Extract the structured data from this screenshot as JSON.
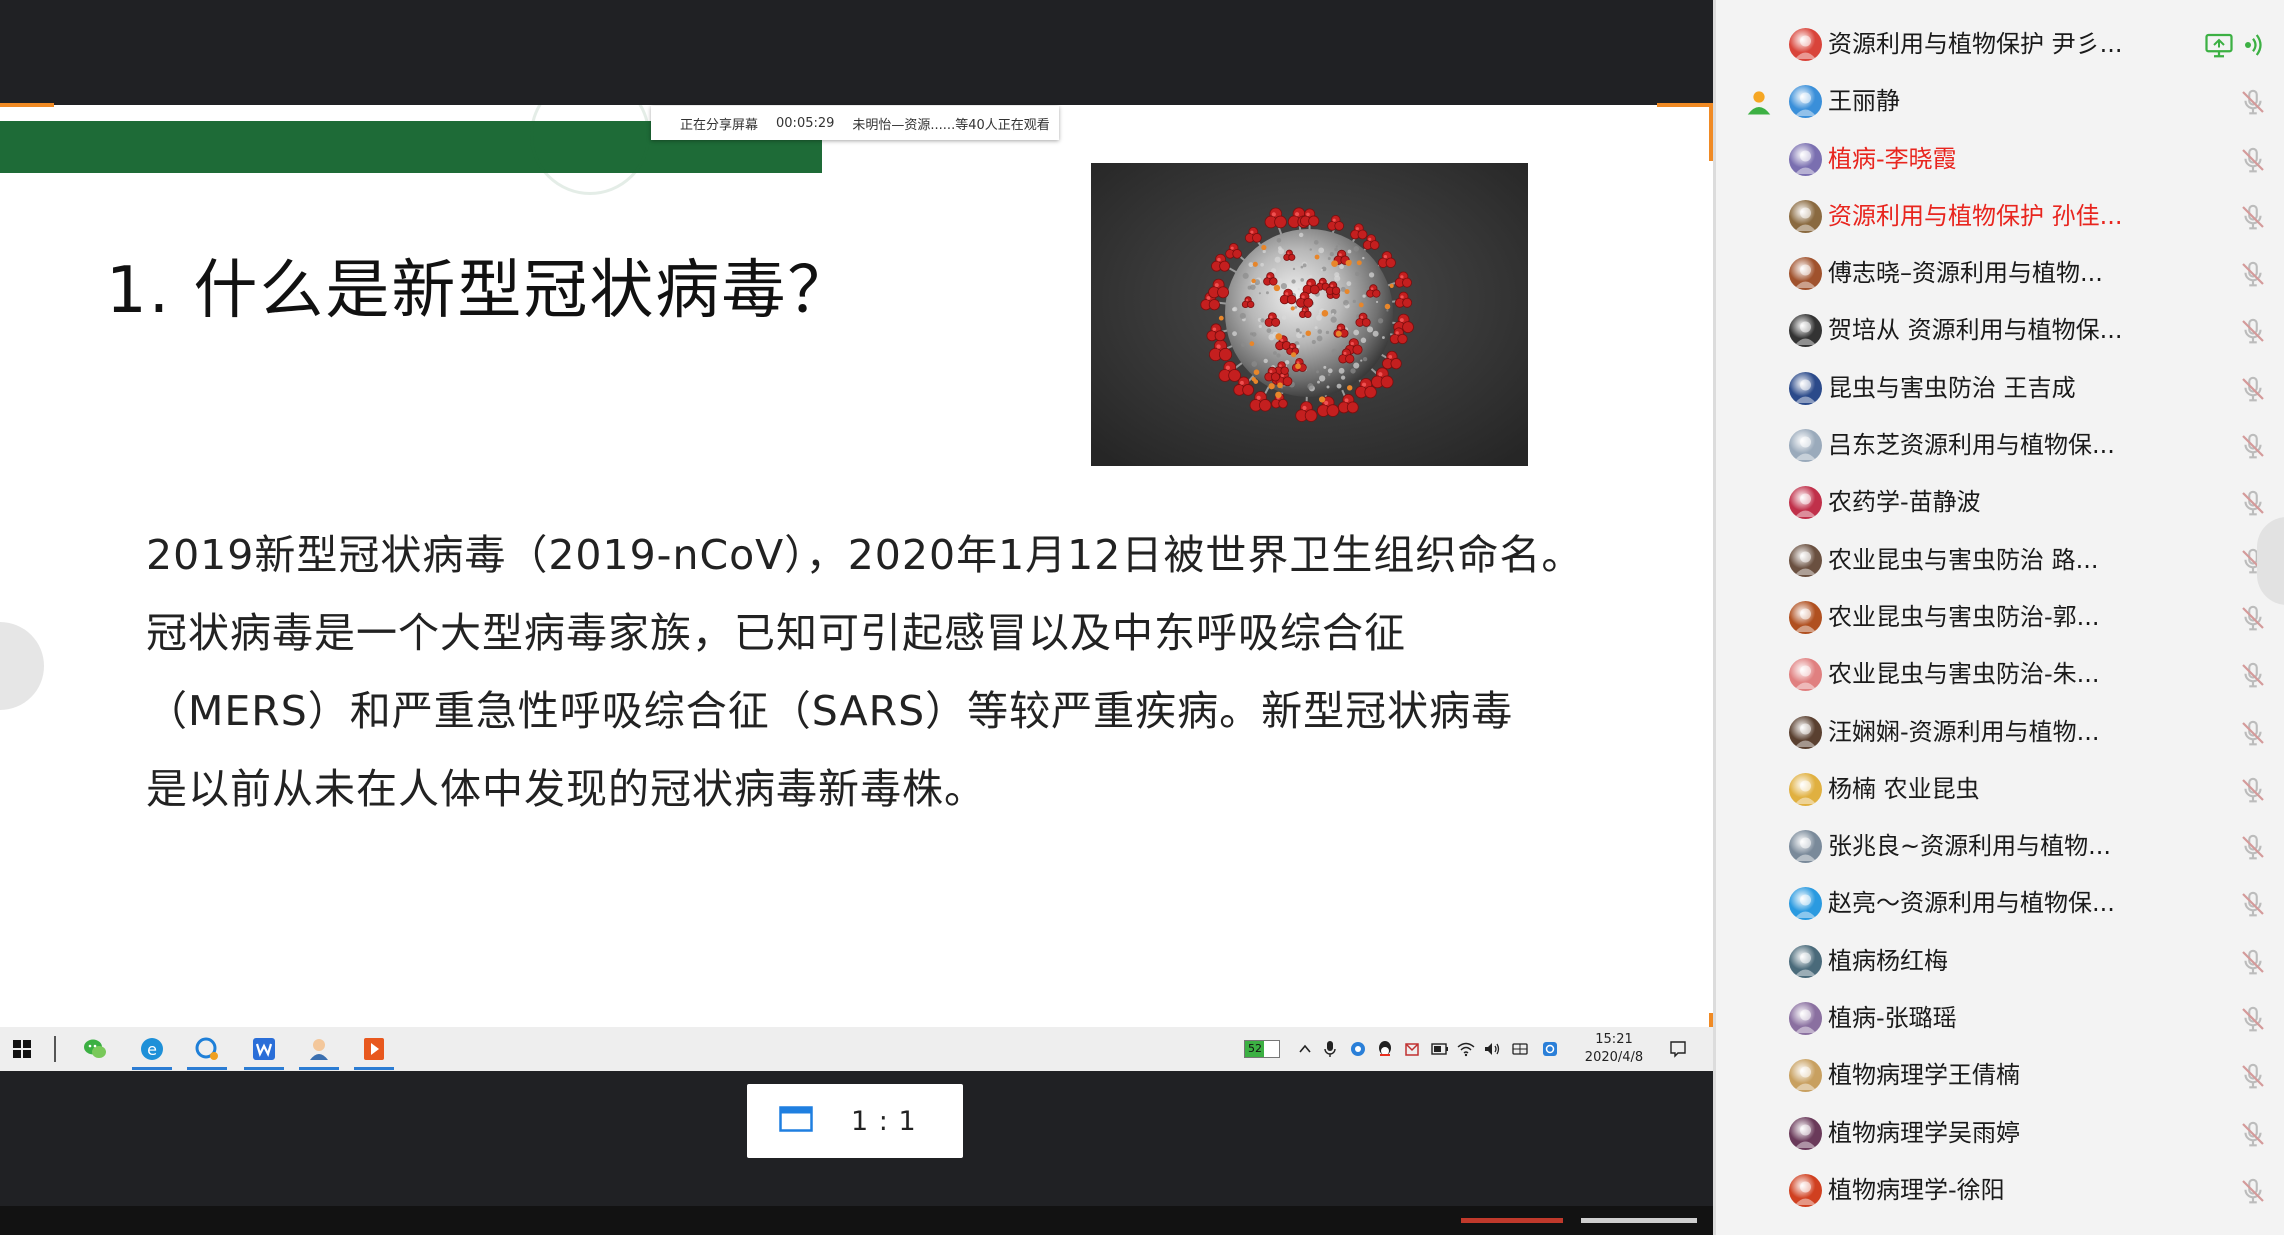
{
  "share_bar": {
    "status": "正在分享屏幕",
    "timer": "00:05:29",
    "viewers": "未明怡—资源......等40人正在观看"
  },
  "slide": {
    "title": "1. 什么是新型冠状病毒？",
    "paragraph": [
      "2019新型冠状病毒（2019-nCoV），2020年1月12日被世界卫生组织命名。",
      "冠状病毒是一个大型病毒家族，已知可引起感冒以及中东呼吸综合征",
      "（MERS）和严重急性呼吸综合征（SARS）等较严重疾病。新型冠状病毒",
      "是以前从未在人体中发现的冠状病毒新毒株。"
    ],
    "image_icon": "coronavirus-illustration"
  },
  "taskbar": {
    "battery": "52",
    "time": "15:21",
    "date": "2020/4/8"
  },
  "view": {
    "zoom_label": "1 : 1"
  },
  "colors": {
    "share_border_orange": "#f08a24",
    "slide_green": "#1e6b37",
    "name_highlight_red": "#e8251e",
    "active_green": "#3cb043"
  },
  "participants": [
    {
      "name": "资源利用与植物保护 尹彡...",
      "red": false,
      "avatar_color": "#d9443a",
      "host": false,
      "sharing": true,
      "mic": "active"
    },
    {
      "name": "王丽静",
      "red": false,
      "avatar_color": "#3a8fd9",
      "host": true,
      "sharing": false,
      "mic": "muted"
    },
    {
      "name": "植病-李晓霞",
      "red": true,
      "avatar_color": "#7a6fb0",
      "host": false,
      "sharing": false,
      "mic": "muted"
    },
    {
      "name": "资源利用与植物保护 孙佳...",
      "red": true,
      "avatar_color": "#8a6a40",
      "host": false,
      "sharing": false,
      "mic": "muted"
    },
    {
      "name": "傅志晓–资源利用与植物...",
      "red": false,
      "avatar_color": "#a0522d",
      "host": false,
      "sharing": false,
      "mic": "muted"
    },
    {
      "name": "贺培从 资源利用与植物保...",
      "red": false,
      "avatar_color": "#333333",
      "host": false,
      "sharing": false,
      "mic": "muted"
    },
    {
      "name": "昆虫与害虫防治 王吉成",
      "red": false,
      "avatar_color": "#2b4a8a",
      "host": false,
      "sharing": false,
      "mic": "muted"
    },
    {
      "name": "吕东芝资源利用与植物保...",
      "red": false,
      "avatar_color": "#9aaabb",
      "host": false,
      "sharing": false,
      "mic": "muted"
    },
    {
      "name": "农药学-苗静波",
      "red": false,
      "avatar_color": "#c0304a",
      "host": false,
      "sharing": false,
      "mic": "muted"
    },
    {
      "name": "农业昆虫与害虫防治 路...",
      "red": false,
      "avatar_color": "#6a5040",
      "host": false,
      "sharing": false,
      "mic": "muted"
    },
    {
      "name": "农业昆虫与害虫防治-郭...",
      "red": false,
      "avatar_color": "#b05020",
      "host": false,
      "sharing": false,
      "mic": "muted"
    },
    {
      "name": "农业昆虫与害虫防治-朱...",
      "red": false,
      "avatar_color": "#e08080",
      "host": false,
      "sharing": false,
      "mic": "muted"
    },
    {
      "name": "汪娴娴-资源利用与植物...",
      "red": false,
      "avatar_color": "#5a4030",
      "host": false,
      "sharing": false,
      "mic": "muted"
    },
    {
      "name": "杨楠 农业昆虫",
      "red": false,
      "avatar_color": "#e0b040",
      "host": false,
      "sharing": false,
      "mic": "muted"
    },
    {
      "name": "张兆良~资源利用与植物...",
      "red": false,
      "avatar_color": "#7a8a9a",
      "host": false,
      "sharing": false,
      "mic": "muted"
    },
    {
      "name": "赵亮～资源利用与植物保...",
      "red": false,
      "avatar_color": "#2a9ae0",
      "host": false,
      "sharing": false,
      "mic": "muted"
    },
    {
      "name": "植病杨红梅",
      "red": false,
      "avatar_color": "#4a6a7a",
      "host": false,
      "sharing": false,
      "mic": "muted"
    },
    {
      "name": "植病-张璐瑶",
      "red": false,
      "avatar_color": "#8a70a0",
      "host": false,
      "sharing": false,
      "mic": "muted"
    },
    {
      "name": "植物病理学王倩楠",
      "red": false,
      "avatar_color": "#c8a060",
      "host": false,
      "sharing": false,
      "mic": "muted"
    },
    {
      "name": "植物病理学吴雨婷",
      "red": false,
      "avatar_color": "#6a3a5a",
      "host": false,
      "sharing": false,
      "mic": "muted"
    },
    {
      "name": "植物病理学-徐阳",
      "red": false,
      "avatar_color": "#d04020",
      "host": false,
      "sharing": false,
      "mic": "muted"
    }
  ]
}
